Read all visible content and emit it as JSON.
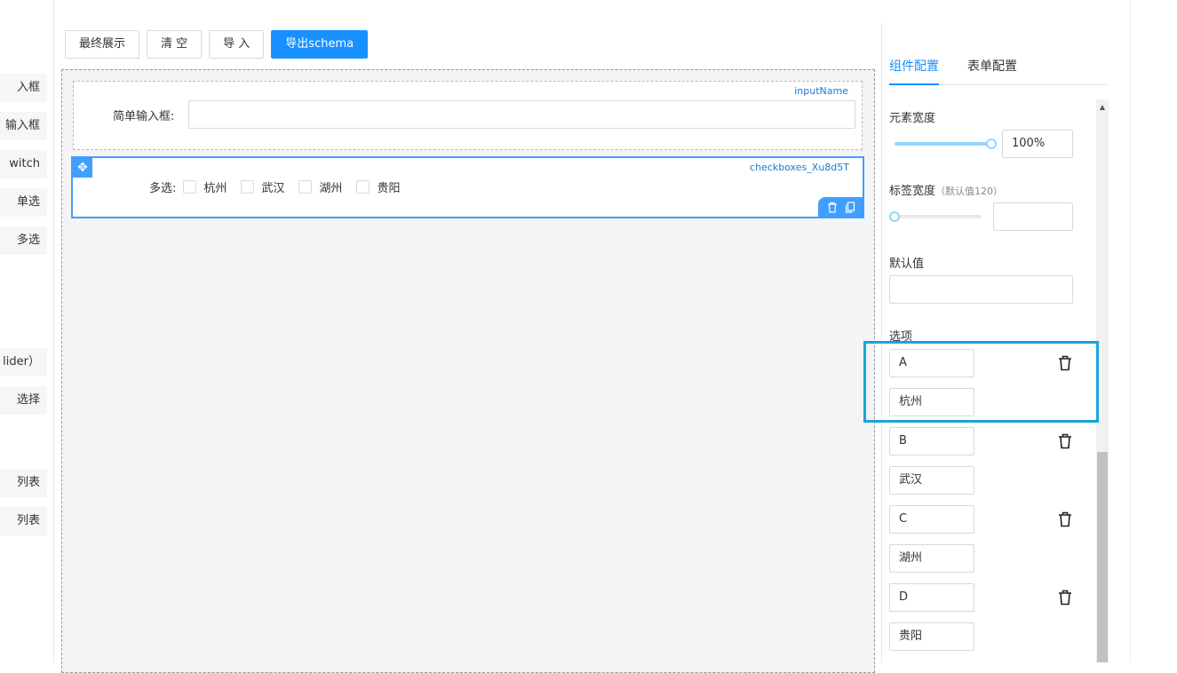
{
  "palette": {
    "items": [
      "入框",
      "输入框",
      "witch",
      "单选",
      "多选",
      "lider）",
      "选择",
      "列表",
      "列表"
    ]
  },
  "toolbar": {
    "final_label": "最终展示",
    "clear_label": "清 空",
    "import_label": "导 入",
    "export_label": "导出schema"
  },
  "canvas": {
    "input_field": {
      "tag": "inputName",
      "label": "简单输入框:"
    },
    "checkbox_field": {
      "tag": "checkboxes_Xu8d5T",
      "label": "多选:",
      "options": [
        "杭州",
        "武汉",
        "湖州",
        "贵阳"
      ]
    }
  },
  "panel": {
    "tabs": [
      "组件配置",
      "表单配置"
    ],
    "width_label": "元素宽度",
    "width_value": "100%",
    "width_slider_value": 1.0,
    "label_width_label": "标签宽度",
    "label_width_hint": "（默认值120）",
    "label_width_slider_value": 0.0,
    "default_label": "默认值",
    "options_label": "选项",
    "options": [
      {
        "value": "A",
        "label": "杭州"
      },
      {
        "value": "B",
        "label": "武汉"
      },
      {
        "value": "C",
        "label": "湖州"
      },
      {
        "value": "D",
        "label": "贵阳"
      }
    ]
  },
  "colors": {
    "accent": "#1890ff",
    "highlight": "#1ba3d8"
  },
  "icons": [
    "move-icon",
    "delete-icon",
    "copy-icon",
    "trash-icon",
    "scroll-up-icon"
  ]
}
